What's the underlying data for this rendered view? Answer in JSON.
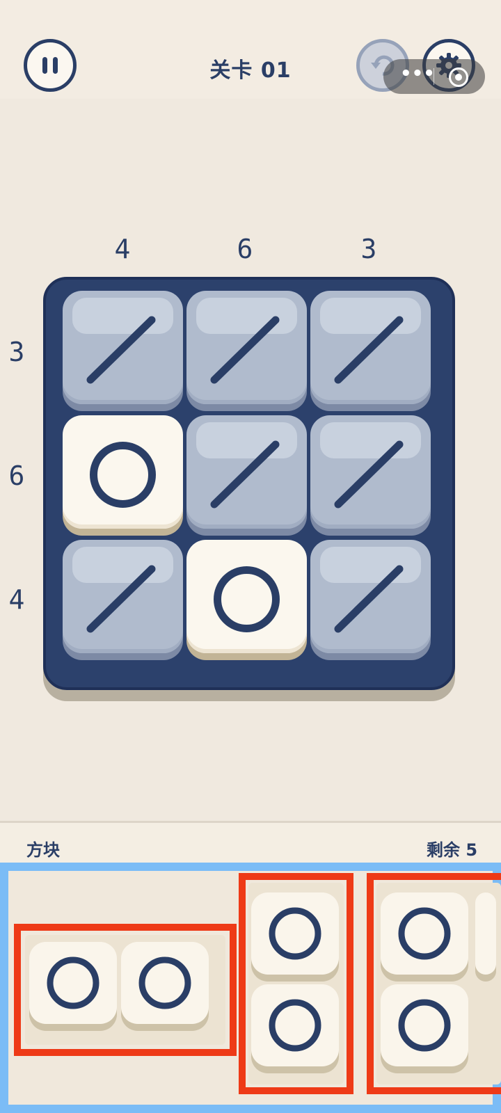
{
  "header": {
    "level_title": "关卡 01",
    "pause_icon": "pause-icon",
    "undo_icon": "undo-icon",
    "settings_icon": "gear-icon",
    "capsule": {
      "more_label": "•••",
      "close_icon": "target-icon"
    }
  },
  "board": {
    "column_clues": [
      "4",
      "6",
      "3"
    ],
    "row_clues": [
      "3",
      "6",
      "4"
    ],
    "cells": [
      [
        "slash",
        "slash",
        "slash"
      ],
      [
        "ring",
        "slash",
        "slash"
      ],
      [
        "slash",
        "ring",
        "slash"
      ]
    ]
  },
  "tray": {
    "title": "方块",
    "remaining": "剩余 5",
    "pieces": [
      {
        "orientation": "horizontal",
        "tiles": [
          "ring",
          "ring"
        ]
      },
      {
        "orientation": "vertical",
        "tiles": [
          "ring",
          "ring"
        ]
      },
      {
        "orientation": "vertical",
        "tiles": [
          "ring",
          "ring"
        ]
      }
    ]
  },
  "colors": {
    "board": "#2c416c",
    "ink": "#2a3e66",
    "slash_tile": "#b0bbcd",
    "ring_tile": "#fbf7ee",
    "highlight_frame": "#7bbcf6",
    "piece_outline": "#ee3a17",
    "background": "#f0e9df"
  }
}
